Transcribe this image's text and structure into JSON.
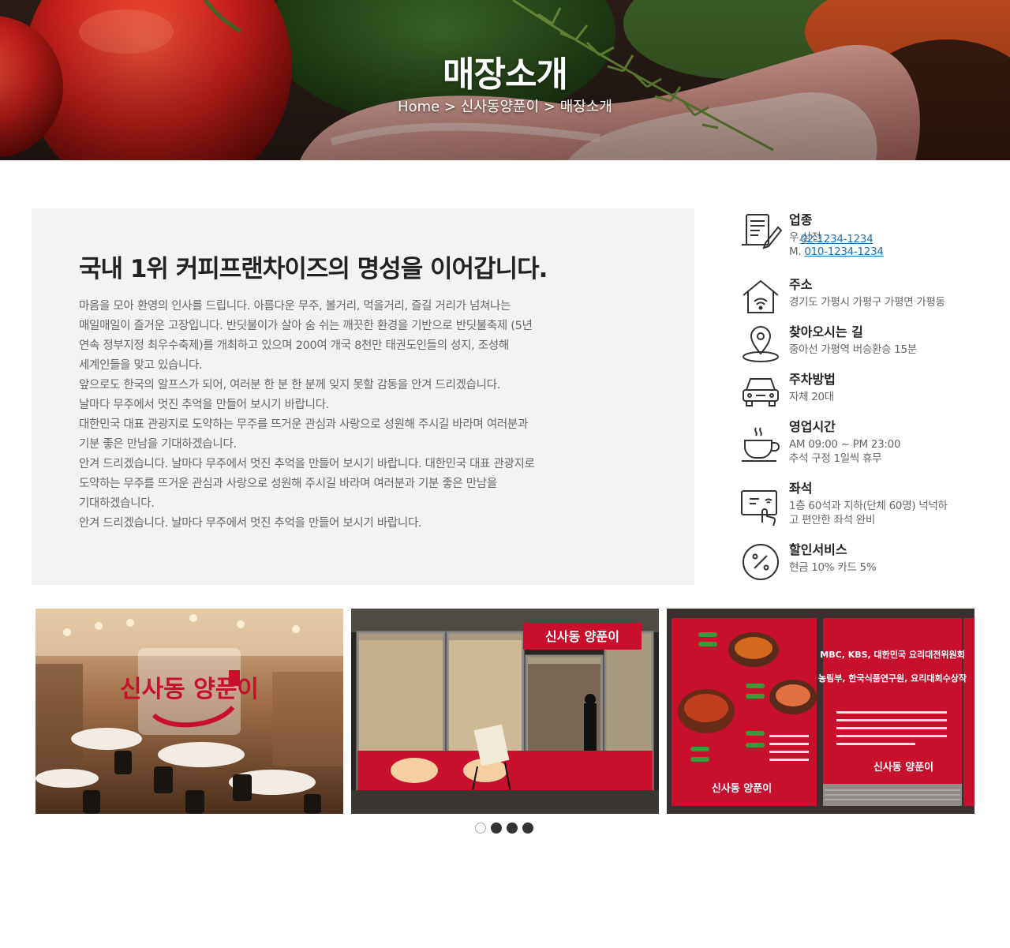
{
  "hero": {
    "title": "매장소개",
    "breadcrumb": [
      "Home",
      "신사동양푼이",
      "매장소개"
    ],
    "separator": ">"
  },
  "intro": {
    "heading": "국내 1위 커피프랜차이즈의 명성을 이어갑니다.",
    "paragraphs": [
      "마음을 모아 환영의 인사를 드립니다. 아름다운 무주, 볼거리, 먹을거리, 즐길 거리가 넘쳐나는",
      "매일매일이 즐거운 고장입니다. 반딧불이가 살아 숨 쉬는 깨끗한 환경을 기반으로 반딧불축제 (5년",
      "연속 정부지정 최우수축제)를 개최하고 있으며 200여 개국 8천만 태권도인들의 성지, 조성해",
      "세계인들을 맞고 있습니다.",
      "앞으로도 한국의 알프스가 되어, 여러분 한 분 한 분께 잊지 못할 감동을 안겨 드리겠습니다.",
      "날마다 무주에서 멋진 추억을 만들어 보시기 바랍니다.",
      "대한민국 대표 관광지로 도약하는 무주를 뜨거운 관심과 사랑으로 성원해 주시길 바라며 여러분과",
      "기분 좋은 만남을 기대하겠습니다.",
      "안겨 드리겠습니다. 날마다 무주에서 멋진 추억을 만들어 보시기 바랍니다. 대한민국 대표 관광지로",
      "도약하는 무주를 뜨거운 관심과 사랑으로 성원해 주시길 바라며 여러분과 기분 좋은 만남을",
      "기대하겠습니다.",
      "안겨 드리겠습니다. 날마다 무주에서 멋진 추억을 만들어 보시기 바랍니다."
    ]
  },
  "info": {
    "items": [
      {
        "icon": "document-pen-icon",
        "title": "업종",
        "lines": [
          "우.상전"
        ],
        "phones": [
          {
            "prefix": "T.",
            "number": "02-1234-1234"
          },
          {
            "prefix": "M.",
            "number": "010-1234-1234"
          }
        ]
      },
      {
        "icon": "home-wifi-icon",
        "title": "주소",
        "lines": [
          "경기도 가평시 가평구 가평면 가평동"
        ]
      },
      {
        "icon": "location-pin-icon",
        "title": "찾아오시는 길",
        "lines": [
          "중아선 가평역 버승환승 15분"
        ]
      },
      {
        "icon": "car-icon",
        "title": "주차방법",
        "lines": [
          "자체 20대"
        ]
      },
      {
        "icon": "coffee-cup-icon",
        "title": "영업시간",
        "lines": [
          "AM 09:00 ~ PM 23:00",
          "추석 구정 1일씩 휴무"
        ]
      },
      {
        "icon": "tablet-touch-icon",
        "title": "좌석",
        "lines": [
          "1층 60석과 지하(단체 60명) 넉넉하",
          "고 편안한 좌석 완비"
        ]
      },
      {
        "icon": "percent-icon",
        "title": "할인서비스",
        "lines": [
          "현금 10% 카드 5%"
        ]
      }
    ]
  },
  "gallery": {
    "slides": [
      {
        "name": "restaurant-interior-photo",
        "logo": "신사동 양푼이"
      },
      {
        "name": "storefront-photo",
        "logo": "신사동 양푼이"
      },
      {
        "name": "menu-poster-photo",
        "heading_lines": [
          "MBC, KBS, 대한민국 요리대전위원회",
          "농림부, 한국식품연구원, 요리대회수상작"
        ],
        "logo": "신사동 양푼이"
      }
    ],
    "dots": 4,
    "active_dot": 0
  },
  "colors": {
    "intro_bg": "#f3f3f3",
    "link": "#1f6fb2",
    "poster_red": "#c8102e"
  }
}
